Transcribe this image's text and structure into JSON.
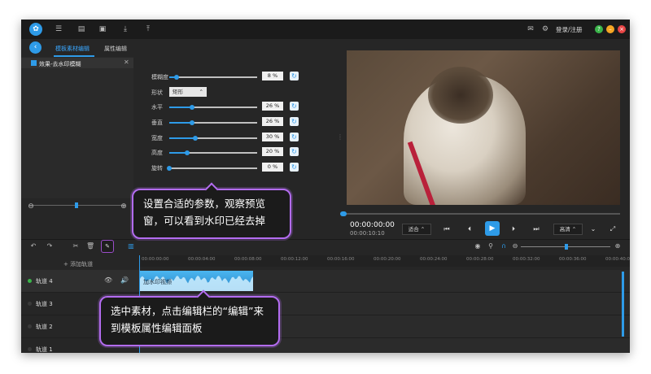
{
  "app": {
    "login": "登录/注册",
    "titlebar_icons": [
      "list-icon",
      "save-icon",
      "save-as-icon",
      "import-icon",
      "export-icon"
    ],
    "window_buttons": [
      {
        "name": "help-button",
        "color": "#3ab54a"
      },
      {
        "name": "minimize-button",
        "color": "#f5a623"
      },
      {
        "name": "close-button",
        "color": "#e84545"
      }
    ]
  },
  "tabs": [
    {
      "label": "模板素材编辑",
      "active": true
    },
    {
      "label": "属性编辑",
      "active": false
    }
  ],
  "effects_list": {
    "items": [
      {
        "label": "效果-去水印模糊",
        "checked": true
      }
    ]
  },
  "properties": {
    "blur": {
      "label": "模糊度",
      "value": "8 %",
      "level": 8
    },
    "shape": {
      "label": "形状",
      "value": "矩形"
    },
    "horizontal": {
      "label": "水平",
      "value": "26 %",
      "level": 26
    },
    "vertical": {
      "label": "垂直",
      "value": "26 %",
      "level": 26
    },
    "width": {
      "label": "宽度",
      "value": "30 %",
      "level": 30
    },
    "height": {
      "label": "高度",
      "value": "20 %",
      "level": 20
    },
    "rotate": {
      "label": "旋转",
      "value": "0 %",
      "level": 0
    }
  },
  "playback": {
    "time": "00:00:00:00",
    "duration": "00:00:10:10",
    "fit": "适合",
    "quality": "高清"
  },
  "timeline": {
    "add_track": "+ 添加轨道",
    "ruler": [
      "00:00:00:00",
      "00:00:04:00",
      "00:00:08:00",
      "00:00:12:00",
      "00:00:16:00",
      "00:00:20:00",
      "00:00:24:00",
      "00:00:28:00",
      "00:00:32:00",
      "00:00:36:00",
      "00:00:40:00"
    ],
    "tracks": [
      {
        "name": "轨道 4"
      },
      {
        "name": "轨道 3"
      },
      {
        "name": "轨道 2"
      },
      {
        "name": "轨道 1"
      }
    ],
    "clip_label": "加水印视频"
  },
  "callouts": {
    "params": "设置合适的参数，观察预览窗，可以看到水印已经去掉",
    "edit": "选中素材，点击编辑栏的“编辑”来到模板属性编辑面板"
  },
  "colors": {
    "accent": "#2e9be8",
    "callout_border": "#b36cf0"
  }
}
